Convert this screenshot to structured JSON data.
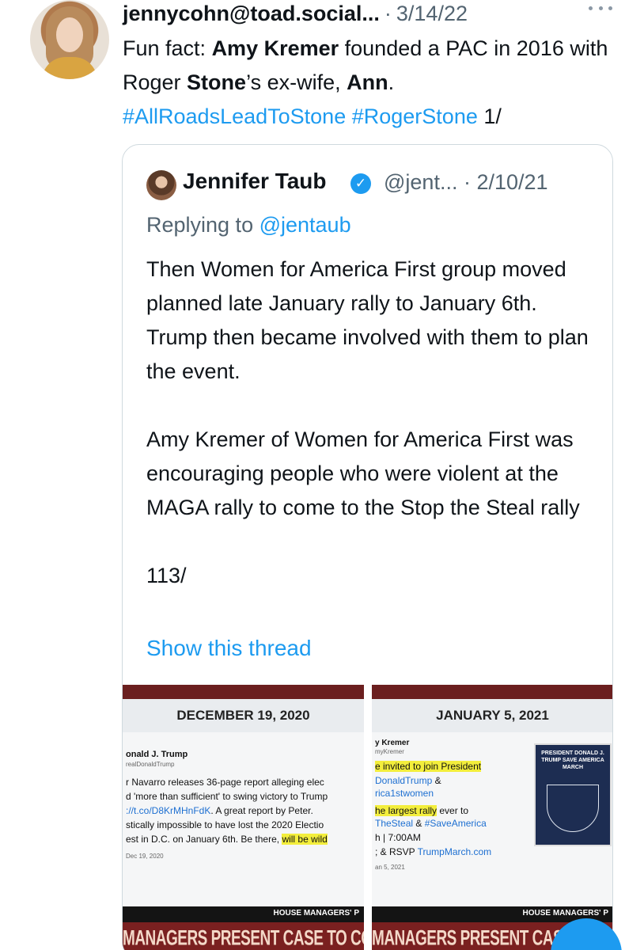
{
  "tweet": {
    "handle": "jennycohn@toad.social...",
    "separator": "·",
    "date": "3/14/22",
    "text_parts": {
      "p1": "Fun fact: ",
      "b1": "Amy Kremer",
      "p2": " founded a PAC in 2016 with Roger ",
      "b2": "Stone",
      "p3": "’s ex-wife, ",
      "b3": "Ann",
      "p4": ".",
      "hashtag1": "#AllRoadsLeadToStone",
      "hashtag2": "#RogerStone",
      "suffix": " 1/"
    }
  },
  "quote": {
    "name": "Jennifer Taub",
    "verified_icon": "✓",
    "handle": "@jent... · 2/10/21",
    "replying_prefix": "Replying to ",
    "replying_mention": "@jentaub",
    "paragraph1": "Then Women for America First group moved planned late January rally to January 6th. Trump then became involved with them to plan the event.",
    "paragraph2": "Amy Kremer of Women for America First was encouraging people who were violent at the MAGA rally to come to the Stop the Steal rally",
    "paragraph3": "113/",
    "show_thread": "Show this thread"
  },
  "media": {
    "left": {
      "date": "DECEMBER 19, 2020",
      "name": "onald J. Trump",
      "username": "realDonaldTrump",
      "line1": "r Navarro releases 36-page report alleging elec",
      "line2": "d 'more than sufficient' to swing victory to Trump",
      "line3_link": "://t.co/D8KrMHnFdK",
      "line3_rest": ". A great report by Peter.",
      "line4": "stically impossible to have lost the 2020 Electio",
      "line5_pre": "est in D.C. on January 6th. Be there, ",
      "line5_hl": "will be wild",
      "timestamp": "Dec 19, 2020",
      "banner": "HOUSE MANAGERS' P",
      "bottom": "MANAGERS PRESENT CASE TO CONVICT TRUM"
    },
    "right": {
      "date": "JANUARY 5, 2021",
      "name": "y Kremer",
      "username": "myKremer",
      "line1": "e invited to join President",
      "line2": "DonaldTrump",
      "line2b": " &",
      "line3": "rica1stwomen",
      "line4_hl": "he largest rally",
      "line4_rest": " ever to",
      "line5_link": "TheSteal",
      "line5_mid": " & ",
      "line5_link2": "#SaveAmerica",
      "line6": "h | 7:00AM",
      "line7_pre": "; & RSVP ",
      "line7_link": "TrumpMarch.com",
      "timestamp": "an 5, 2021",
      "poster": "PRESIDENT DONALD J. TRUMP SAVE AMERICA MARCH",
      "banner": "HOUSE MANAGERS' P",
      "bottom": "MANAGERS PRESENT CASE TO CONVICT TRUM"
    }
  },
  "colors": {
    "link": "#1d9bf0",
    "secondary": "#536471",
    "text": "#0f1419",
    "border": "#cfd9de"
  }
}
